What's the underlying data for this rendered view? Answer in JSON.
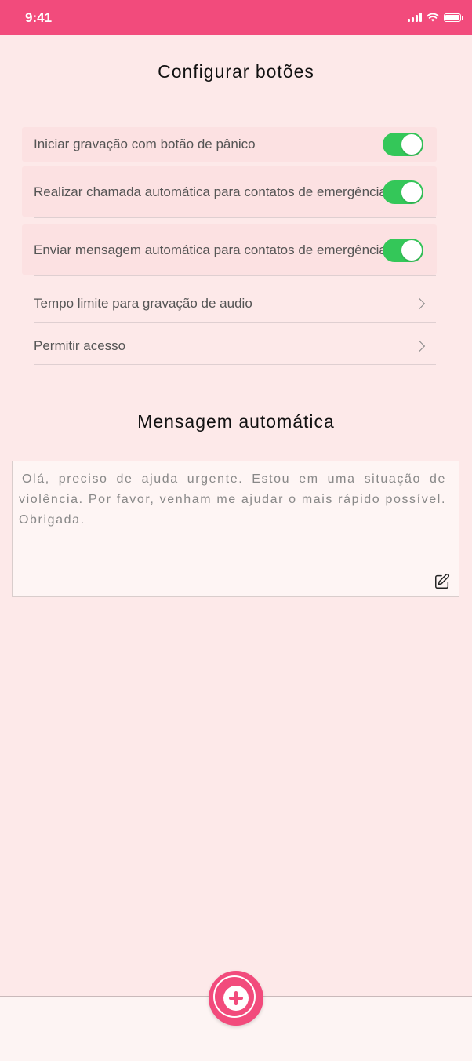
{
  "status_bar": {
    "time": "9:41"
  },
  "settings": {
    "title": "Configurar botões",
    "items": [
      {
        "label": "Iniciar gravação com botão de pânico",
        "type": "toggle",
        "on": true
      },
      {
        "label": "Realizar chamada automática para contatos de emergência",
        "type": "toggle",
        "on": true
      },
      {
        "label": "Enviar mensagem automática para contatos de emergência",
        "type": "toggle",
        "on": true
      },
      {
        "label": "Tempo limite para gravação de audio",
        "type": "link"
      },
      {
        "label": "Permitir acesso",
        "type": "link"
      }
    ]
  },
  "auto_message": {
    "title": "Mensagem automática",
    "text": "Olá, preciso de ajuda urgente. Estou em uma situação de violência. Por favor, venham me ajudar o mais rápido possível. Obrigada."
  },
  "colors": {
    "brand": "#f24b7c",
    "toggle_on": "#34c759",
    "background": "#fde9e9"
  },
  "icons": {
    "edit": "edit-icon",
    "fab": "plus-icon"
  }
}
